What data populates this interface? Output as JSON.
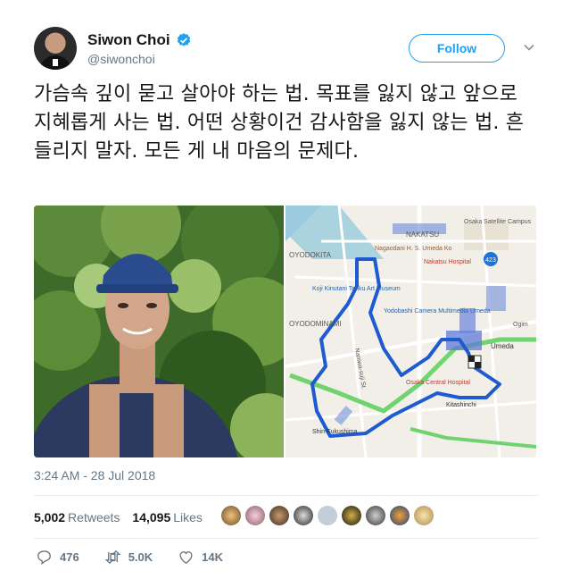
{
  "user": {
    "display_name": "Siwon Choi",
    "handle": "@siwonchoi",
    "follow_label": "Follow"
  },
  "tweet": {
    "text": "가슴속 깊이 묻고 살아야 하는 법. 목표를 잃지 않고 앞으로 지혜롭게 사는 법. 어떤 상황이건 감사함을 잃지 않는 법. 흔들리지 말자. 모든 게 내 마음의 문제다.",
    "timestamp": "3:24 AM - 28 Jul 2018"
  },
  "stats": {
    "retweets_count": "5,002",
    "retweets_label": "Retweets",
    "likes_count": "14,095",
    "likes_label": "Likes"
  },
  "actions": {
    "replies": "476",
    "retweets": "5.0K",
    "likes": "14K"
  },
  "map": {
    "labels": {
      "nakatsu": "NAKATSU",
      "oyodokita": "OYODOKITA",
      "oyodominami": "OYODOMINAMI",
      "nagaodani": "Nagaodani H. S. Umeda Ko",
      "nakatsu_hospital": "Nakatsu Hospital",
      "kinutani": "Koji Kinutani Tenku Art Museum",
      "yodobashi": "Yodobashi Camera Multimedia Umeda",
      "umeda": "Umeda",
      "osaka_central": "Osaka Central Hospital",
      "kitashinchi": "Kitashinchi",
      "shin_fukushima": "Shin-Fukushima",
      "ogimachi": "Ogim",
      "satellite": "Osaka Satellite Campus",
      "road_423": "423",
      "naniwa_suji": "Naniwa-suji St."
    }
  },
  "colors": {
    "accent": "#1da1f2",
    "route": "#1565c0",
    "text_secondary": "#657786"
  }
}
